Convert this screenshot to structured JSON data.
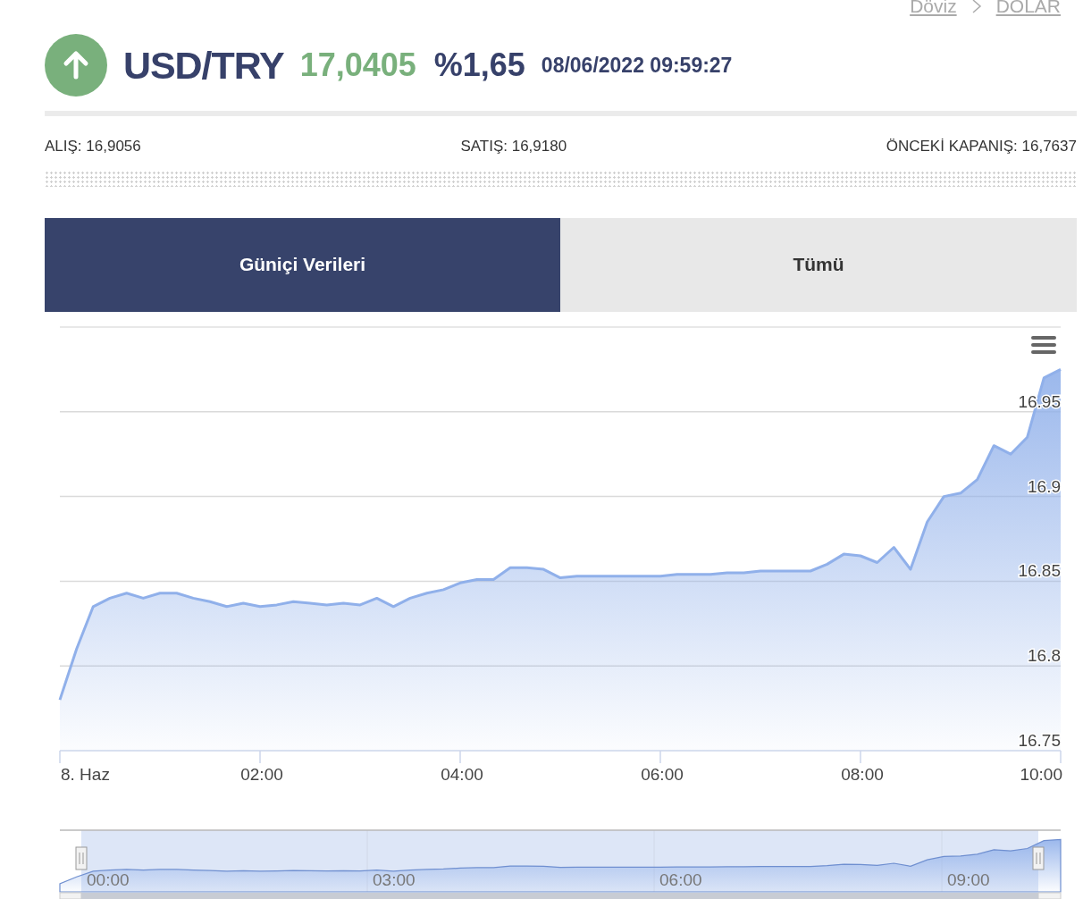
{
  "breadcrumb": [
    {
      "label": "Döviz"
    },
    {
      "label": "DOLAR"
    }
  ],
  "quote": {
    "symbol": "USD/TRY",
    "price": "17,0405",
    "change": "%1,65",
    "timestamp": "08/06/2022 09:59:27",
    "rising": true
  },
  "stats": [
    {
      "label": "ALIŞ: 16,9056"
    },
    {
      "label": "SATIŞ: 16,9180"
    },
    {
      "label": "ÖNCEKİ KAPANIŞ: 16,7637"
    }
  ],
  "tabs": [
    {
      "label": "Güniçi Verileri",
      "selected": true
    },
    {
      "label": "Tümü",
      "selected": false
    }
  ],
  "chart_data": {
    "type": "area",
    "x": [
      "2022-06-08T00:00",
      "2022-06-08T00:10",
      "2022-06-08T00:20",
      "2022-06-08T00:30",
      "2022-06-08T00:40",
      "2022-06-08T00:50",
      "2022-06-08T01:00",
      "2022-06-08T01:10",
      "2022-06-08T01:20",
      "2022-06-08T01:30",
      "2022-06-08T01:40",
      "2022-06-08T01:50",
      "2022-06-08T02:00",
      "2022-06-08T02:10",
      "2022-06-08T02:20",
      "2022-06-08T02:30",
      "2022-06-08T02:40",
      "2022-06-08T02:50",
      "2022-06-08T03:00",
      "2022-06-08T03:10",
      "2022-06-08T03:20",
      "2022-06-08T03:30",
      "2022-06-08T03:40",
      "2022-06-08T03:50",
      "2022-06-08T04:00",
      "2022-06-08T04:10",
      "2022-06-08T04:20",
      "2022-06-08T04:30",
      "2022-06-08T04:40",
      "2022-06-08T04:50",
      "2022-06-08T05:00",
      "2022-06-08T05:10",
      "2022-06-08T05:20",
      "2022-06-08T05:30",
      "2022-06-08T05:40",
      "2022-06-08T05:50",
      "2022-06-08T06:00",
      "2022-06-08T06:10",
      "2022-06-08T06:20",
      "2022-06-08T06:30",
      "2022-06-08T06:40",
      "2022-06-08T06:50",
      "2022-06-08T07:00",
      "2022-06-08T07:10",
      "2022-06-08T07:20",
      "2022-06-08T07:30",
      "2022-06-08T07:40",
      "2022-06-08T07:50",
      "2022-06-08T08:00",
      "2022-06-08T08:10",
      "2022-06-08T08:20",
      "2022-06-08T08:30",
      "2022-06-08T08:40",
      "2022-06-08T08:50",
      "2022-06-08T09:00",
      "2022-06-08T09:10",
      "2022-06-08T09:20",
      "2022-06-08T09:30",
      "2022-06-08T09:40",
      "2022-06-08T09:50",
      "2022-06-08T10:00"
    ],
    "series": [
      {
        "color": "#90b0ea",
        "values": [
          16.78,
          16.81,
          16.835,
          16.84,
          16.843,
          16.84,
          16.843,
          16.843,
          16.84,
          16.838,
          16.835,
          16.837,
          16.835,
          16.836,
          16.838,
          16.837,
          16.836,
          16.837,
          16.836,
          16.84,
          16.835,
          16.84,
          16.843,
          16.845,
          16.849,
          16.851,
          16.851,
          16.858,
          16.858,
          16.857,
          16.852,
          16.853,
          16.853,
          16.853,
          16.853,
          16.853,
          16.853,
          16.854,
          16.854,
          16.854,
          16.855,
          16.855,
          16.856,
          16.856,
          16.856,
          16.856,
          16.86,
          16.866,
          16.865,
          16.861,
          16.87,
          16.857,
          16.885,
          16.9,
          16.902,
          16.91,
          16.93,
          16.925,
          16.935,
          16.97,
          16.975
        ]
      }
    ],
    "xlim": [
      "2022-06-08T00:00",
      "2022-06-08T10:00"
    ],
    "ylim": [
      16.75,
      17.0
    ],
    "grid": true,
    "xticks": [
      {
        "value": "2022-06-08T00:00",
        "label": "8. Haz"
      },
      {
        "value": "2022-06-08T02:00",
        "label": "02:00"
      },
      {
        "value": "2022-06-08T04:00",
        "label": "04:00"
      },
      {
        "value": "2022-06-08T06:00",
        "label": "06:00"
      },
      {
        "value": "2022-06-08T08:00",
        "label": "08:00"
      },
      {
        "value": "2022-06-08T10:00",
        "label": "10:00"
      }
    ],
    "yticks": [
      16.75,
      {
        "value": 16.8,
        "label": "16.8"
      },
      16.85,
      {
        "value": 16.9,
        "label": "16.9"
      },
      16.95
    ]
  },
  "navigator": {
    "labels": [
      "00:00",
      "03:00",
      "06:00",
      "09:00"
    ]
  }
}
